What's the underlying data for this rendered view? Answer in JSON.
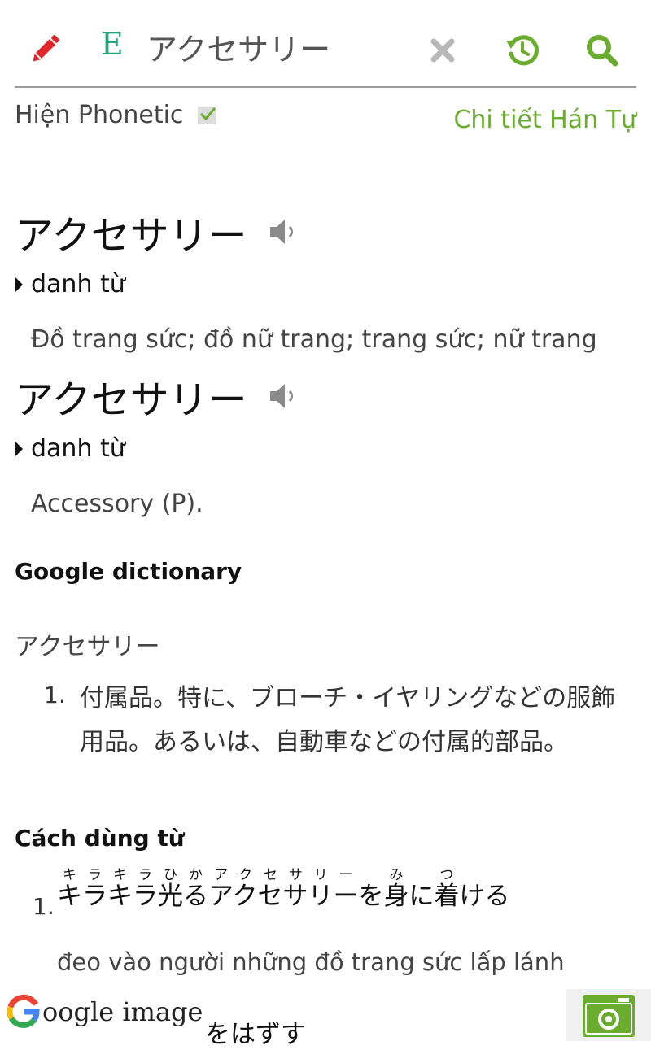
{
  "search": {
    "query": "アクセサリー",
    "lang_badge": "E"
  },
  "options": {
    "phonetic_label": "Hiện Phonetic",
    "phonetic_checked": true,
    "kanji_link": "Chi tiết Hán Tự"
  },
  "entries": [
    {
      "word": "アクセサリー",
      "pos": "danh từ",
      "meaning": "Đồ trang sức; đồ nữ trang; trang sức; nữ trang"
    },
    {
      "word": "アクセサリー",
      "pos": "danh từ",
      "meaning": "Accessory (P)."
    }
  ],
  "google_dictionary": {
    "title": "Google dictionary",
    "word": "アクセサリー",
    "definitions": [
      {
        "num": "1.",
        "text": "付属品。特に、ブローチ・イヤリングなどの服飾用品。あるいは、自動車などの付属的部品。"
      }
    ]
  },
  "usage": {
    "title": "Cách dùng từ",
    "examples": [
      {
        "num": "1.",
        "segments": [
          {
            "base": "キラキラ光る",
            "ruby": "キラキラひか"
          },
          {
            "base": "アクセサリー",
            "ruby": "アクセサリー"
          },
          {
            "base": "を",
            "ruby": ""
          },
          {
            "base": "身",
            "ruby": "み"
          },
          {
            "base": "に",
            "ruby": ""
          },
          {
            "base": "着",
            "ruby": "つ"
          },
          {
            "base": "ける",
            "ruby": ""
          }
        ],
        "translation": "đeo vào người những đồ trang sức lấp lánh"
      }
    ],
    "partial_example": "をはずす"
  },
  "footer": {
    "google_image_label": "oogle image"
  },
  "colors": {
    "accent_green": "#6aac2e",
    "edit_red": "#e0262b",
    "badge_teal": "#2aa37d"
  },
  "icons": [
    "pencil-icon",
    "close-icon",
    "history-icon",
    "search-icon",
    "speaker-icon",
    "google-g-icon",
    "camera-icon"
  ]
}
